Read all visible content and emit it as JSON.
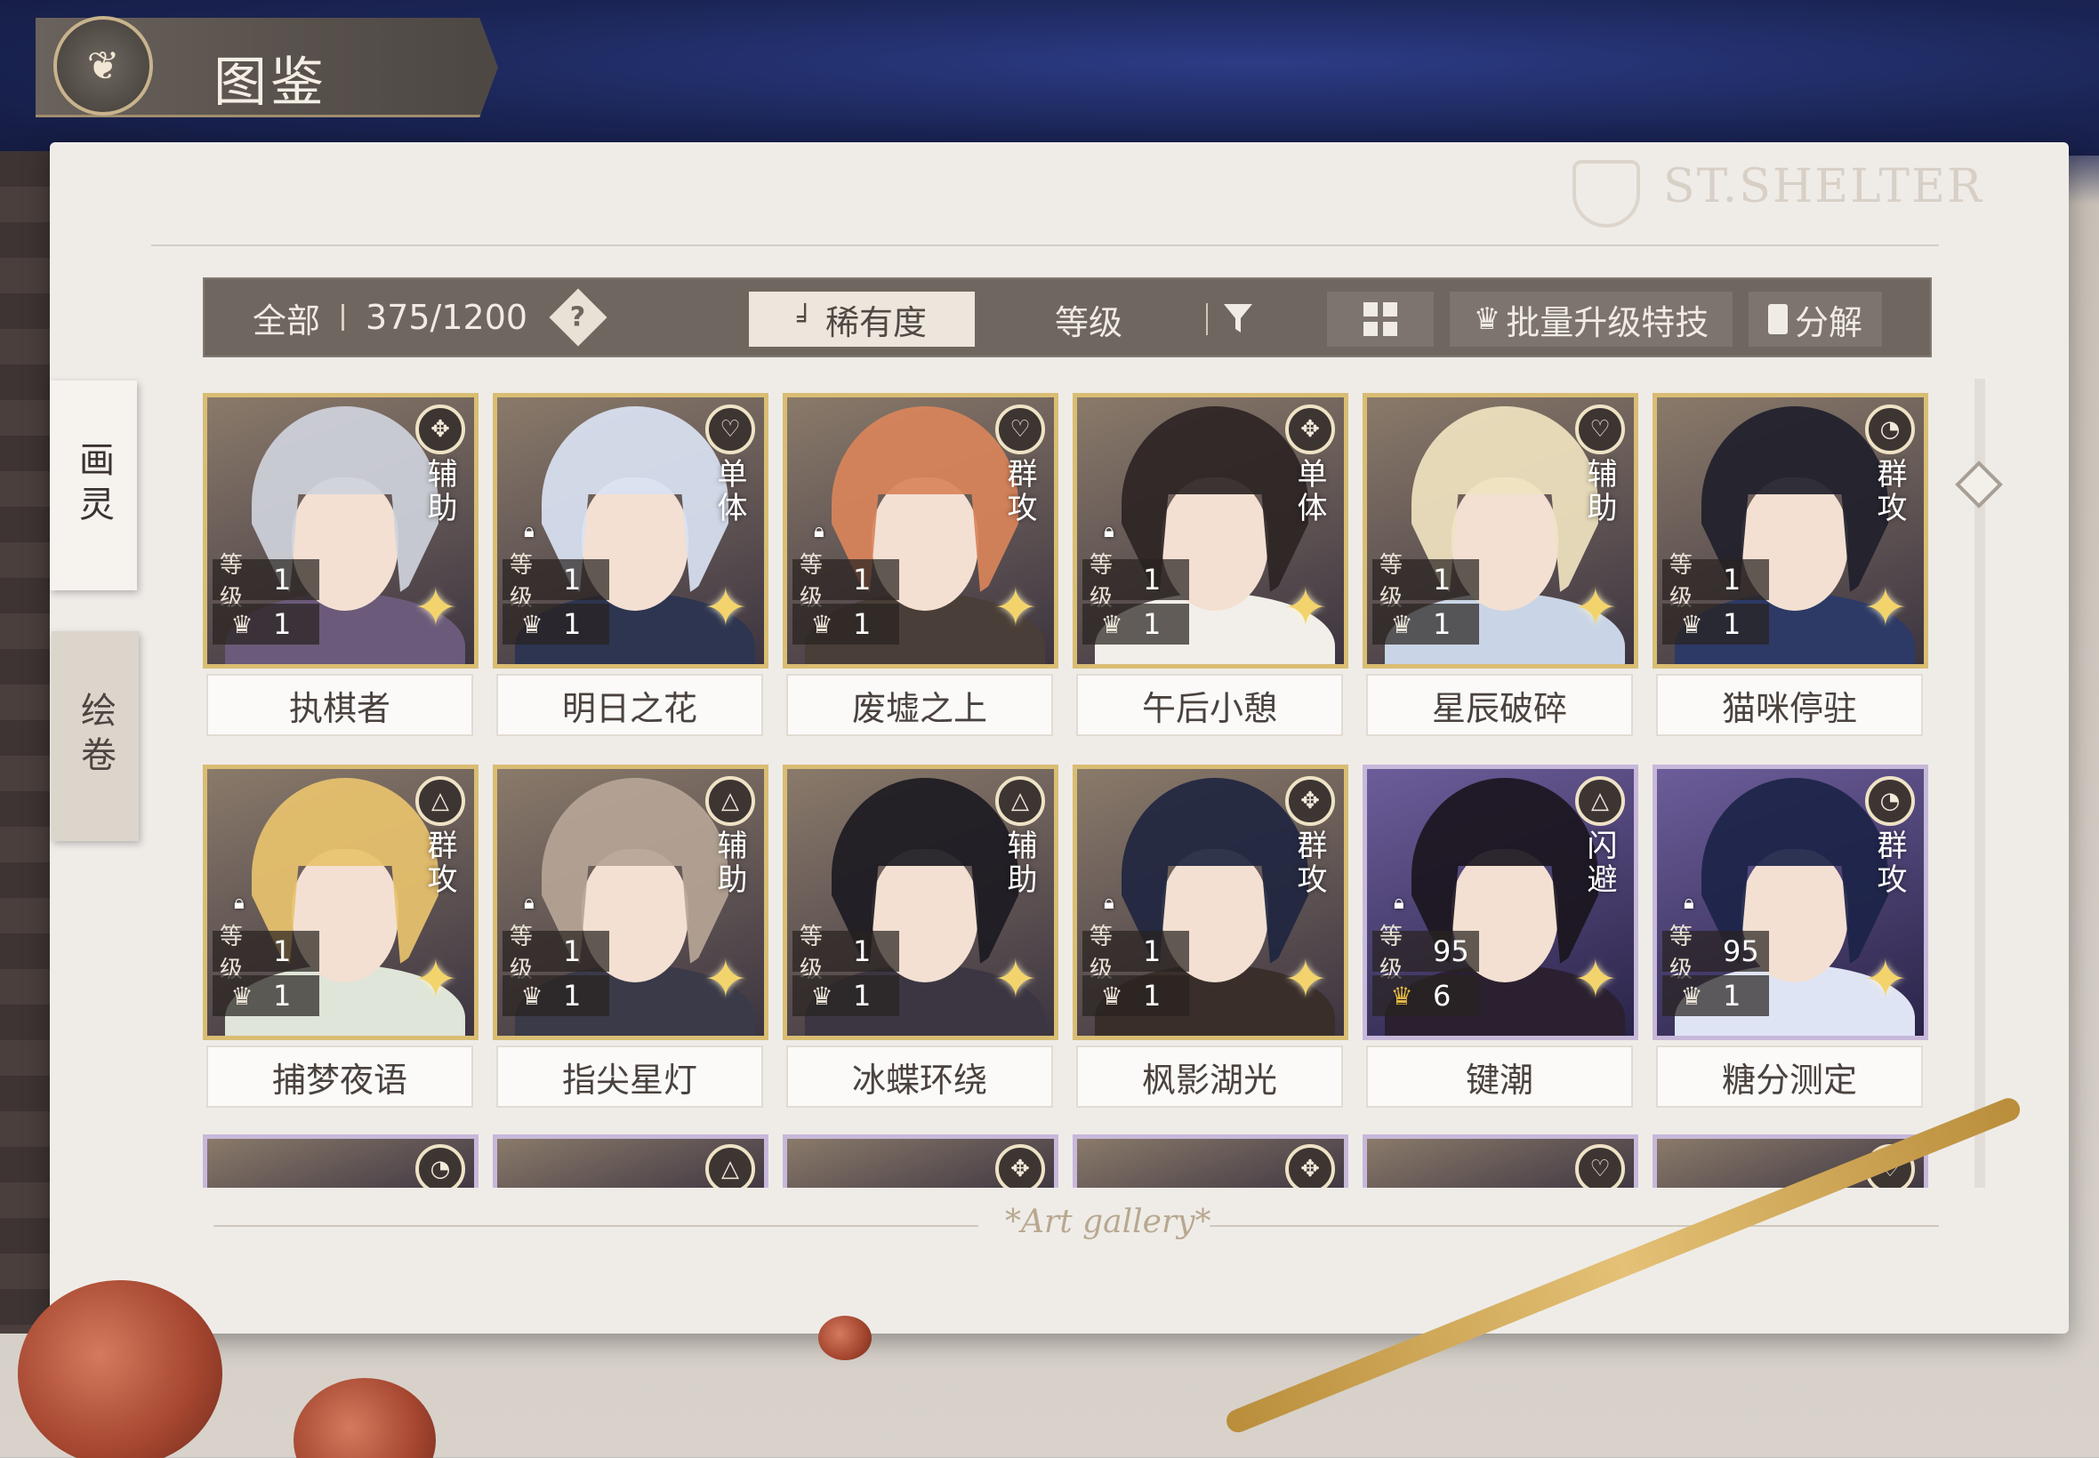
{
  "header": {
    "title": "图鉴",
    "emblem_icon": "butterfly-icon"
  },
  "watermark": "ST.SHELTER",
  "side_tabs": [
    {
      "label": "画灵",
      "active": true
    },
    {
      "label": "绘卷",
      "active": false
    }
  ],
  "toolbar": {
    "filter_label": "全部",
    "count": "375/1200",
    "help_icon": "?",
    "sort_rarity": "稀有度",
    "sort_level": "等级",
    "filter_icon": "funnel-icon",
    "grid_icon": "grid-icon",
    "batch_upgrade": "批量升级特技",
    "decompose": "分解"
  },
  "stat_labels": {
    "level": "等级"
  },
  "cards": [
    {
      "name": "执棋者",
      "role": "辅助",
      "type_icon": "✥",
      "level": "1",
      "stars": "1",
      "locked": false,
      "frame": "gold",
      "hair": "#cfd2dc",
      "outfit": "#6b5a7a"
    },
    {
      "name": "明日之花",
      "role": "单体",
      "type_icon": "♡",
      "level": "1",
      "stars": "1",
      "locked": true,
      "frame": "gold",
      "hair": "#d9e2f2",
      "outfit": "#2d3550"
    },
    {
      "name": "废墟之上",
      "role": "群攻",
      "type_icon": "♡",
      "level": "1",
      "stars": "1",
      "locked": true,
      "frame": "gold",
      "hair": "#d9845a",
      "outfit": "#4a3e38"
    },
    {
      "name": "午后小憩",
      "role": "单体",
      "type_icon": "✥",
      "level": "1",
      "stars": "1",
      "locked": true,
      "frame": "gold",
      "hair": "#2d2424",
      "outfit": "#f2efea"
    },
    {
      "name": "星辰破碎",
      "role": "辅助",
      "type_icon": "♡",
      "level": "1",
      "stars": "1",
      "locked": false,
      "frame": "gold",
      "hair": "#efe3c0",
      "outfit": "#c9d5e6"
    },
    {
      "name": "猫咪停驻",
      "role": "群攻",
      "type_icon": "◔",
      "level": "1",
      "stars": "1",
      "locked": false,
      "frame": "gold",
      "hair": "#1f1f2b",
      "outfit": "#2d3a66"
    },
    {
      "name": "捕梦夜语",
      "role": "群攻",
      "type_icon": "△",
      "level": "1",
      "stars": "1",
      "locked": true,
      "frame": "gold",
      "hair": "#e8c26e",
      "outfit": "#dfe5d8"
    },
    {
      "name": "指尖星灯",
      "role": "辅助",
      "type_icon": "△",
      "level": "1",
      "stars": "1",
      "locked": true,
      "frame": "gold",
      "hair": "#b6a596",
      "outfit": "#3a3a48"
    },
    {
      "name": "冰蝶环绕",
      "role": "辅助",
      "type_icon": "△",
      "level": "1",
      "stars": "1",
      "locked": false,
      "frame": "gold",
      "hair": "#1c1a22",
      "outfit": "#3c3642"
    },
    {
      "name": "枫影湖光",
      "role": "群攻",
      "type_icon": "✥",
      "level": "1",
      "stars": "1",
      "locked": true,
      "frame": "gold",
      "hair": "#1f2640",
      "outfit": "#3a2e2a"
    },
    {
      "name": "键潮",
      "role": "闪避",
      "type_icon": "△",
      "level": "95",
      "stars": "6",
      "locked": true,
      "frame": "purple",
      "hair": "#1b1620",
      "outfit": "#2a2030"
    },
    {
      "name": "糖分测定",
      "role": "群攻",
      "type_icon": "◔",
      "level": "95",
      "stars": "1",
      "locked": true,
      "frame": "purple",
      "hair": "#1c2448",
      "outfit": "#dfe4f4"
    }
  ],
  "partial_row_icons": [
    "◔",
    "△",
    "✥",
    "✥",
    "♡",
    "♡"
  ],
  "partial_row_frames": [
    "purple",
    "purple",
    "purple",
    "purple",
    "purple",
    "purple"
  ],
  "footer": "*Art gallery*"
}
